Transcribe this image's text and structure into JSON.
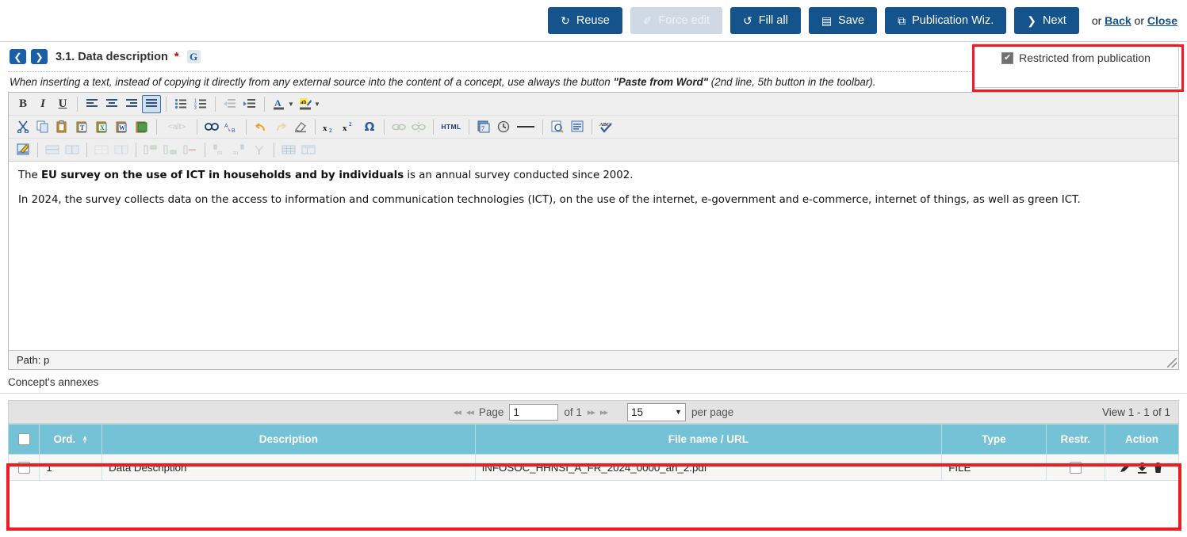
{
  "toolbar": {
    "buttons": [
      {
        "label": "Reuse",
        "icon": "refresh-icon",
        "glyph": "↻",
        "disabled": false
      },
      {
        "label": "Force edit",
        "icon": "pencil-icon",
        "glyph": "✐",
        "disabled": true
      },
      {
        "label": "Fill all",
        "icon": "sync-icon",
        "glyph": "↺",
        "disabled": false
      },
      {
        "label": "Save",
        "icon": "floppy-disk-icon",
        "glyph": "▤",
        "disabled": false
      },
      {
        "label": "Publication Wiz.",
        "icon": "wizard-icon",
        "glyph": "⧉",
        "disabled": false
      },
      {
        "label": "Next",
        "icon": "chevron-right-icon",
        "glyph": "❯",
        "disabled": false
      }
    ],
    "or_text_1": "or",
    "back_label": "Back",
    "or_text_2": "or",
    "close_label": "Close"
  },
  "section": {
    "prev_icon": "chevron-left-icon",
    "next_icon": "chevron-right-icon",
    "title": "3.1. Data description",
    "required_marker": "*",
    "g_badge": "G",
    "restricted_label": "Restricted from publication",
    "restricted_checked": true,
    "restricted_check_glyph": "✔"
  },
  "hint": {
    "part1": "When inserting a text, instead of copying it directly from any external source into the content of a concept, use always the button ",
    "bold": "\"Paste from Word\"",
    "part2": " (2nd line, 5th button in the toolbar)."
  },
  "editor": {
    "row1": [
      {
        "name": "bold-icon",
        "glyph": "B",
        "style": "bold-serif",
        "active": false,
        "dim": false
      },
      {
        "name": "italic-icon",
        "glyph": "I",
        "style": "italic-serif",
        "active": false,
        "dim": false
      },
      {
        "name": "underline-icon",
        "glyph": "U",
        "style": "underline-serif",
        "active": false,
        "dim": false
      },
      {
        "sep": true
      },
      {
        "name": "align-left-icon",
        "glyph": "lines-left",
        "active": false,
        "dim": false
      },
      {
        "name": "align-center-icon",
        "glyph": "lines-center",
        "active": false,
        "dim": false
      },
      {
        "name": "align-right-icon",
        "glyph": "lines-right",
        "active": false,
        "dim": false
      },
      {
        "name": "align-justify-icon",
        "glyph": "lines-justify",
        "active": true,
        "dim": false
      },
      {
        "sep": true
      },
      {
        "name": "bulleted-list-icon",
        "glyph": "ul",
        "active": false,
        "dim": false
      },
      {
        "name": "numbered-list-icon",
        "glyph": "ol",
        "active": false,
        "dim": false
      },
      {
        "sep": true
      },
      {
        "name": "outdent-icon",
        "glyph": "outdent",
        "active": false,
        "dim": true
      },
      {
        "name": "indent-icon",
        "glyph": "indent",
        "active": false,
        "dim": false
      },
      {
        "sep": true
      },
      {
        "name": "text-color-icon",
        "glyph": "textcolor",
        "active": false,
        "dim": false
      },
      {
        "name": "text-color-dropdown-caret",
        "glyph": "caret",
        "active": false,
        "dim": false
      },
      {
        "name": "highlight-color-icon",
        "glyph": "highlight",
        "active": false,
        "dim": false
      },
      {
        "name": "highlight-color-dropdown-caret",
        "glyph": "caret",
        "active": false,
        "dim": false
      }
    ],
    "row2": [
      {
        "name": "cut-icon",
        "glyph": "scissors",
        "dim": false
      },
      {
        "name": "copy-icon",
        "glyph": "copy",
        "dim": false
      },
      {
        "name": "paste-icon",
        "glyph": "clipboard",
        "dim": false
      },
      {
        "name": "paste-as-text-icon",
        "glyph": "clip-t",
        "dim": false
      },
      {
        "name": "paste-from-excel-icon",
        "glyph": "clip-x",
        "dim": false
      },
      {
        "name": "paste-from-word-icon",
        "glyph": "clip-w",
        "dim": false
      },
      {
        "name": "paste-green-icon",
        "glyph": "clip-g",
        "dim": false
      },
      {
        "sep": true
      },
      {
        "name": "alt-text-icon",
        "glyph": "alt",
        "dim": true
      },
      {
        "sep": true
      },
      {
        "name": "find-icon",
        "glyph": "binocular",
        "dim": false
      },
      {
        "name": "replace-icon",
        "glyph": "replace",
        "dim": false
      },
      {
        "sep": true
      },
      {
        "name": "undo-icon",
        "glyph": "undo",
        "dim": false
      },
      {
        "name": "redo-icon",
        "glyph": "redo",
        "dim": true
      },
      {
        "name": "remove-format-icon",
        "glyph": "eraser",
        "dim": false
      },
      {
        "sep": true
      },
      {
        "name": "subscript-icon",
        "glyph": "sub",
        "dim": false
      },
      {
        "name": "superscript-icon",
        "glyph": "sup",
        "dim": false
      },
      {
        "name": "special-character-icon",
        "glyph": "omega",
        "dim": false
      },
      {
        "sep": true
      },
      {
        "name": "link-icon",
        "glyph": "link",
        "dim": true
      },
      {
        "name": "unlink-icon",
        "glyph": "unlink",
        "dim": true
      },
      {
        "sep": true
      },
      {
        "name": "html-source-icon",
        "glyph": "HTML",
        "dim": false
      },
      {
        "sep": true
      },
      {
        "name": "template-icon",
        "glyph": "template",
        "dim": false
      },
      {
        "name": "clock-icon",
        "glyph": "clock",
        "dim": false
      },
      {
        "name": "horizontal-rule-icon",
        "glyph": "hr",
        "dim": false
      },
      {
        "sep": true
      },
      {
        "name": "preview-icon",
        "glyph": "preview",
        "dim": false
      },
      {
        "name": "show-blocks-icon",
        "glyph": "blocks",
        "dim": false
      },
      {
        "sep": true
      },
      {
        "name": "spell-check-icon",
        "glyph": "abc-check",
        "dim": false
      }
    ],
    "row3": [
      {
        "name": "edit-properties-icon",
        "glyph": "notepad-pencil",
        "dim": false
      },
      {
        "sep": true
      },
      {
        "name": "insert-row-icon",
        "glyph": "tbl-row",
        "dim": true
      },
      {
        "name": "insert-column-icon",
        "glyph": "tbl-col",
        "dim": true
      },
      {
        "sep": true
      },
      {
        "name": "merge-cells-icon",
        "glyph": "tbl-merge",
        "dim": true
      },
      {
        "name": "split-cell-icon",
        "glyph": "tbl-split",
        "dim": true
      },
      {
        "sep": true
      },
      {
        "name": "row-insert-above-icon",
        "glyph": "row-above",
        "dim": true
      },
      {
        "name": "row-insert-below-icon",
        "glyph": "row-below",
        "dim": true
      },
      {
        "name": "row-delete-icon",
        "glyph": "row-del",
        "dim": true
      },
      {
        "sep": true
      },
      {
        "name": "col-insert-left-icon",
        "glyph": "col-left",
        "dim": true
      },
      {
        "name": "col-insert-right-icon",
        "glyph": "col-right",
        "dim": true
      },
      {
        "name": "col-delete-icon",
        "glyph": "col-del",
        "dim": true
      },
      {
        "sep": true
      },
      {
        "name": "table-grid-icon",
        "glyph": "tbl-grid",
        "dim": true
      },
      {
        "name": "table-properties-icon",
        "glyph": "tbl-props",
        "dim": true
      }
    ],
    "content": {
      "p1_a": "The ",
      "p1_b": "EU survey on the use of ICT in households and by individuals",
      "p1_c": " is an annual survey conducted since 2002.",
      "p2": "In 2024, the survey collects data on the access to information and communication technologies (ICT), on the use of the internet, e-government and e-commerce, internet of things, as well as green ICT."
    },
    "path_label": "Path: p"
  },
  "annexes": {
    "section_label": "Concept's annexes",
    "pager": {
      "first_icon": "first-page-icon",
      "prev_icon": "prev-page-icon",
      "page_label": "Page",
      "page_value": "1",
      "of_label": "of 1",
      "next_icon": "next-page-icon",
      "last_icon": "last-page-icon",
      "per_page_value": "15",
      "per_page_label": "per page",
      "view_info": "View 1 - 1 of 1"
    },
    "columns": [
      {
        "label": "",
        "name": "select-all-checkbox-column"
      },
      {
        "label": "Ord.",
        "name": "ord-column",
        "sortable": true,
        "sort": "asc"
      },
      {
        "label": "Description",
        "name": "description-column"
      },
      {
        "label": "File name / URL",
        "name": "filename-url-column"
      },
      {
        "label": "Type",
        "name": "type-column"
      },
      {
        "label": "Restr.",
        "name": "restr-column"
      },
      {
        "label": "Action",
        "name": "action-column"
      }
    ],
    "rows": [
      {
        "selected": false,
        "ord": "1",
        "description": "Data Description",
        "file_name": "INFOSOC_HHNSI_A_FR_2024_0000_an_2.pdf",
        "type": "FILE",
        "restricted": false,
        "actions": [
          "edit-icon",
          "download-icon",
          "delete-icon"
        ]
      }
    ]
  },
  "colors": {
    "primary_button": "#14538c",
    "disabled_button": "#cfd9e4",
    "table_header": "#73c2d6",
    "highlight_border": "#ee1c24",
    "link": "#14538c"
  }
}
